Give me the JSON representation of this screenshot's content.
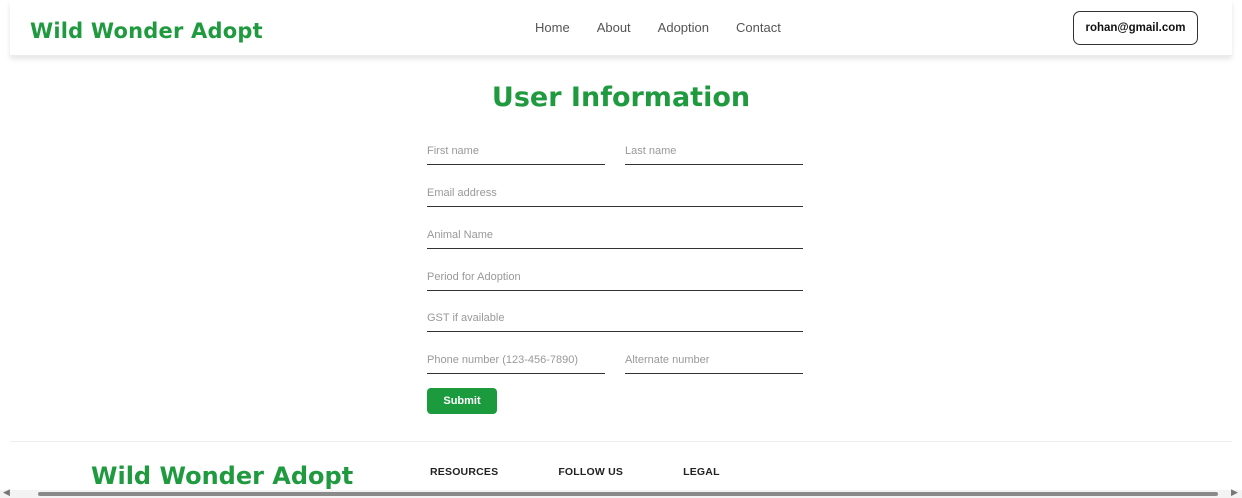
{
  "header": {
    "brand": "Wild Wonder Adopt",
    "nav": [
      "Home",
      "About",
      "Adoption",
      "Contact"
    ],
    "user_email": "rohan@gmail.com"
  },
  "form": {
    "title": "User Information",
    "first_name_placeholder": "First name",
    "last_name_placeholder": "Last name",
    "email_placeholder": "Email address",
    "animal_placeholder": "Animal Name",
    "period_placeholder": "Period for Adoption",
    "gst_placeholder": "GST if available",
    "phone_placeholder": "Phone number (123-456-7890)",
    "alt_phone_placeholder": "Alternate number",
    "submit_label": "Submit"
  },
  "footer": {
    "brand": "Wild Wonder Adopt",
    "columns": [
      "RESOURCES",
      "FOLLOW US",
      "LEGAL"
    ]
  },
  "icons": {
    "scroll_left": "chevron-left-icon",
    "scroll_right": "chevron-right-icon"
  },
  "colors": {
    "brand_green": "#1f9a3f",
    "button_green": "#1c9a3e"
  }
}
